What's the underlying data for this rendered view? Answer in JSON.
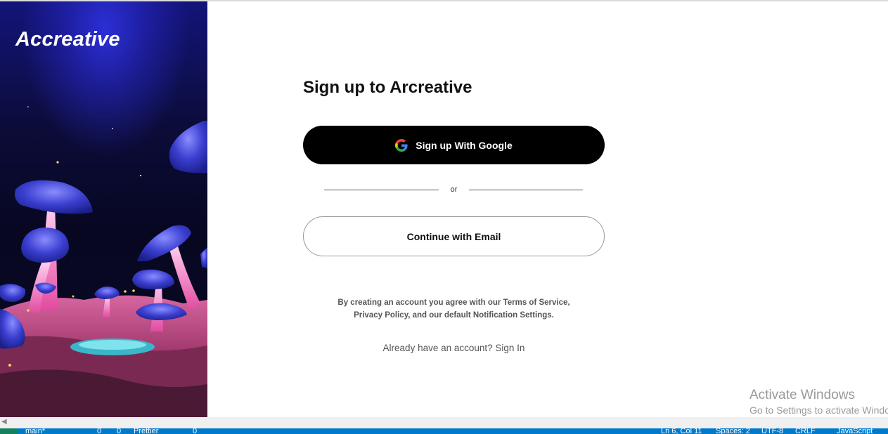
{
  "left_panel": {
    "brand": "Accreative",
    "art": "fantasy-mushroom-landscape"
  },
  "signup": {
    "title": "Sign up to Arcreative",
    "google_label": "Sign up With Google",
    "divider_text": "or",
    "email_label": "Continue with Email",
    "terms_line1": "By creating an account you agree with our Terms of Service,",
    "terms_line2": "Privacy Policy, and our default Notification Settings.",
    "signin_text": "Already have an account? Sign In"
  },
  "watermark": {
    "line1": "Activate Windows",
    "line2": "Go to Settings to activate Windows."
  },
  "status_bar": {
    "branch": "main*",
    "errors": "0",
    "warnings": "0",
    "prettier": "Prettier",
    "ports": "0",
    "position": "Ln 6, Col 11",
    "spaces": "Spaces: 2",
    "encoding": "UTF-8",
    "eol": "CRLF",
    "language": "JavaScript"
  },
  "colors": {
    "google_button_bg": "#000000",
    "status_bar_bg": "#007acc",
    "panel_dark": "#0c0c3a",
    "panel_glow": "#2b2fd6"
  }
}
